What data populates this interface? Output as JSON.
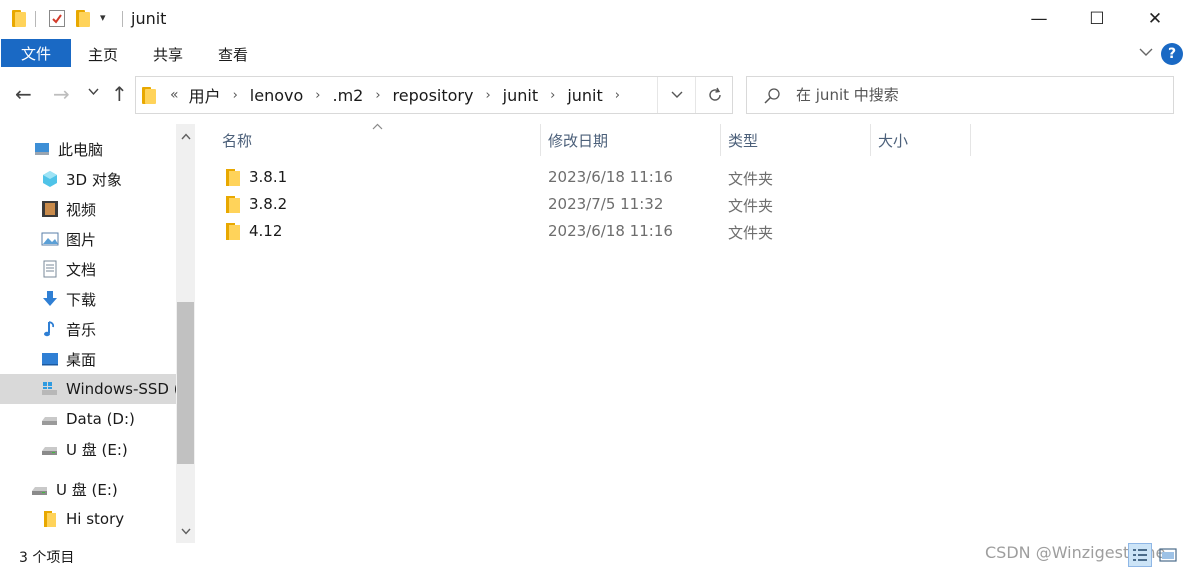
{
  "window": {
    "title": "junit",
    "minimize_glyph": "—",
    "maximize_glyph": "☐",
    "close_glyph": "✕"
  },
  "ribbon": {
    "file_tab": "文件",
    "tabs": [
      "主页",
      "共享",
      "查看"
    ],
    "help_glyph": "?"
  },
  "nav": {
    "back_glyph": "←",
    "forward_glyph": "→",
    "recent_glyph": "⌄",
    "up_glyph": "↑",
    "address": {
      "overflow": "«",
      "crumbs": [
        "用户",
        "lenovo",
        ".m2",
        "repository",
        "junit",
        "junit"
      ]
    },
    "search_placeholder": "在 junit 中搜索"
  },
  "sidebar": {
    "items": [
      {
        "label": "此电脑",
        "icon": "computer-icon"
      },
      {
        "label": "3D 对象",
        "icon": "3d-objects-icon"
      },
      {
        "label": "视频",
        "icon": "video-icon"
      },
      {
        "label": "图片",
        "icon": "pictures-icon"
      },
      {
        "label": "文档",
        "icon": "documents-icon"
      },
      {
        "label": "下载",
        "icon": "download-icon"
      },
      {
        "label": "音乐",
        "icon": "music-icon"
      },
      {
        "label": "桌面",
        "icon": "desktop-icon"
      },
      {
        "label": "Windows-SSD (",
        "icon": "windows-drive-icon",
        "selected": true
      },
      {
        "label": "Data (D:)",
        "icon": "drive-icon"
      },
      {
        "label": "U 盘 (E:)",
        "icon": "usb-drive-icon"
      },
      {
        "label": "U 盘 (E:)",
        "icon": "usb-drive-icon"
      },
      {
        "label": "Hi story",
        "icon": "folder-icon"
      }
    ]
  },
  "table": {
    "columns": [
      "名称",
      "修改日期",
      "类型",
      "大小"
    ],
    "rows": [
      {
        "name": "3.8.1",
        "date": "2023/6/18 11:16",
        "type": "文件夹",
        "size": ""
      },
      {
        "name": "3.8.2",
        "date": "2023/7/5 11:32",
        "type": "文件夹",
        "size": ""
      },
      {
        "name": "4.12",
        "date": "2023/6/18 11:16",
        "type": "文件夹",
        "size": ""
      }
    ]
  },
  "status": {
    "count": "3 个项目",
    "watermark": "CSDN @Winzigesterne"
  },
  "colors": {
    "accent": "#1a69c4",
    "folder_back": "#e8a800",
    "folder_front": "#ffd35a",
    "selection": "#d9d9d9"
  }
}
